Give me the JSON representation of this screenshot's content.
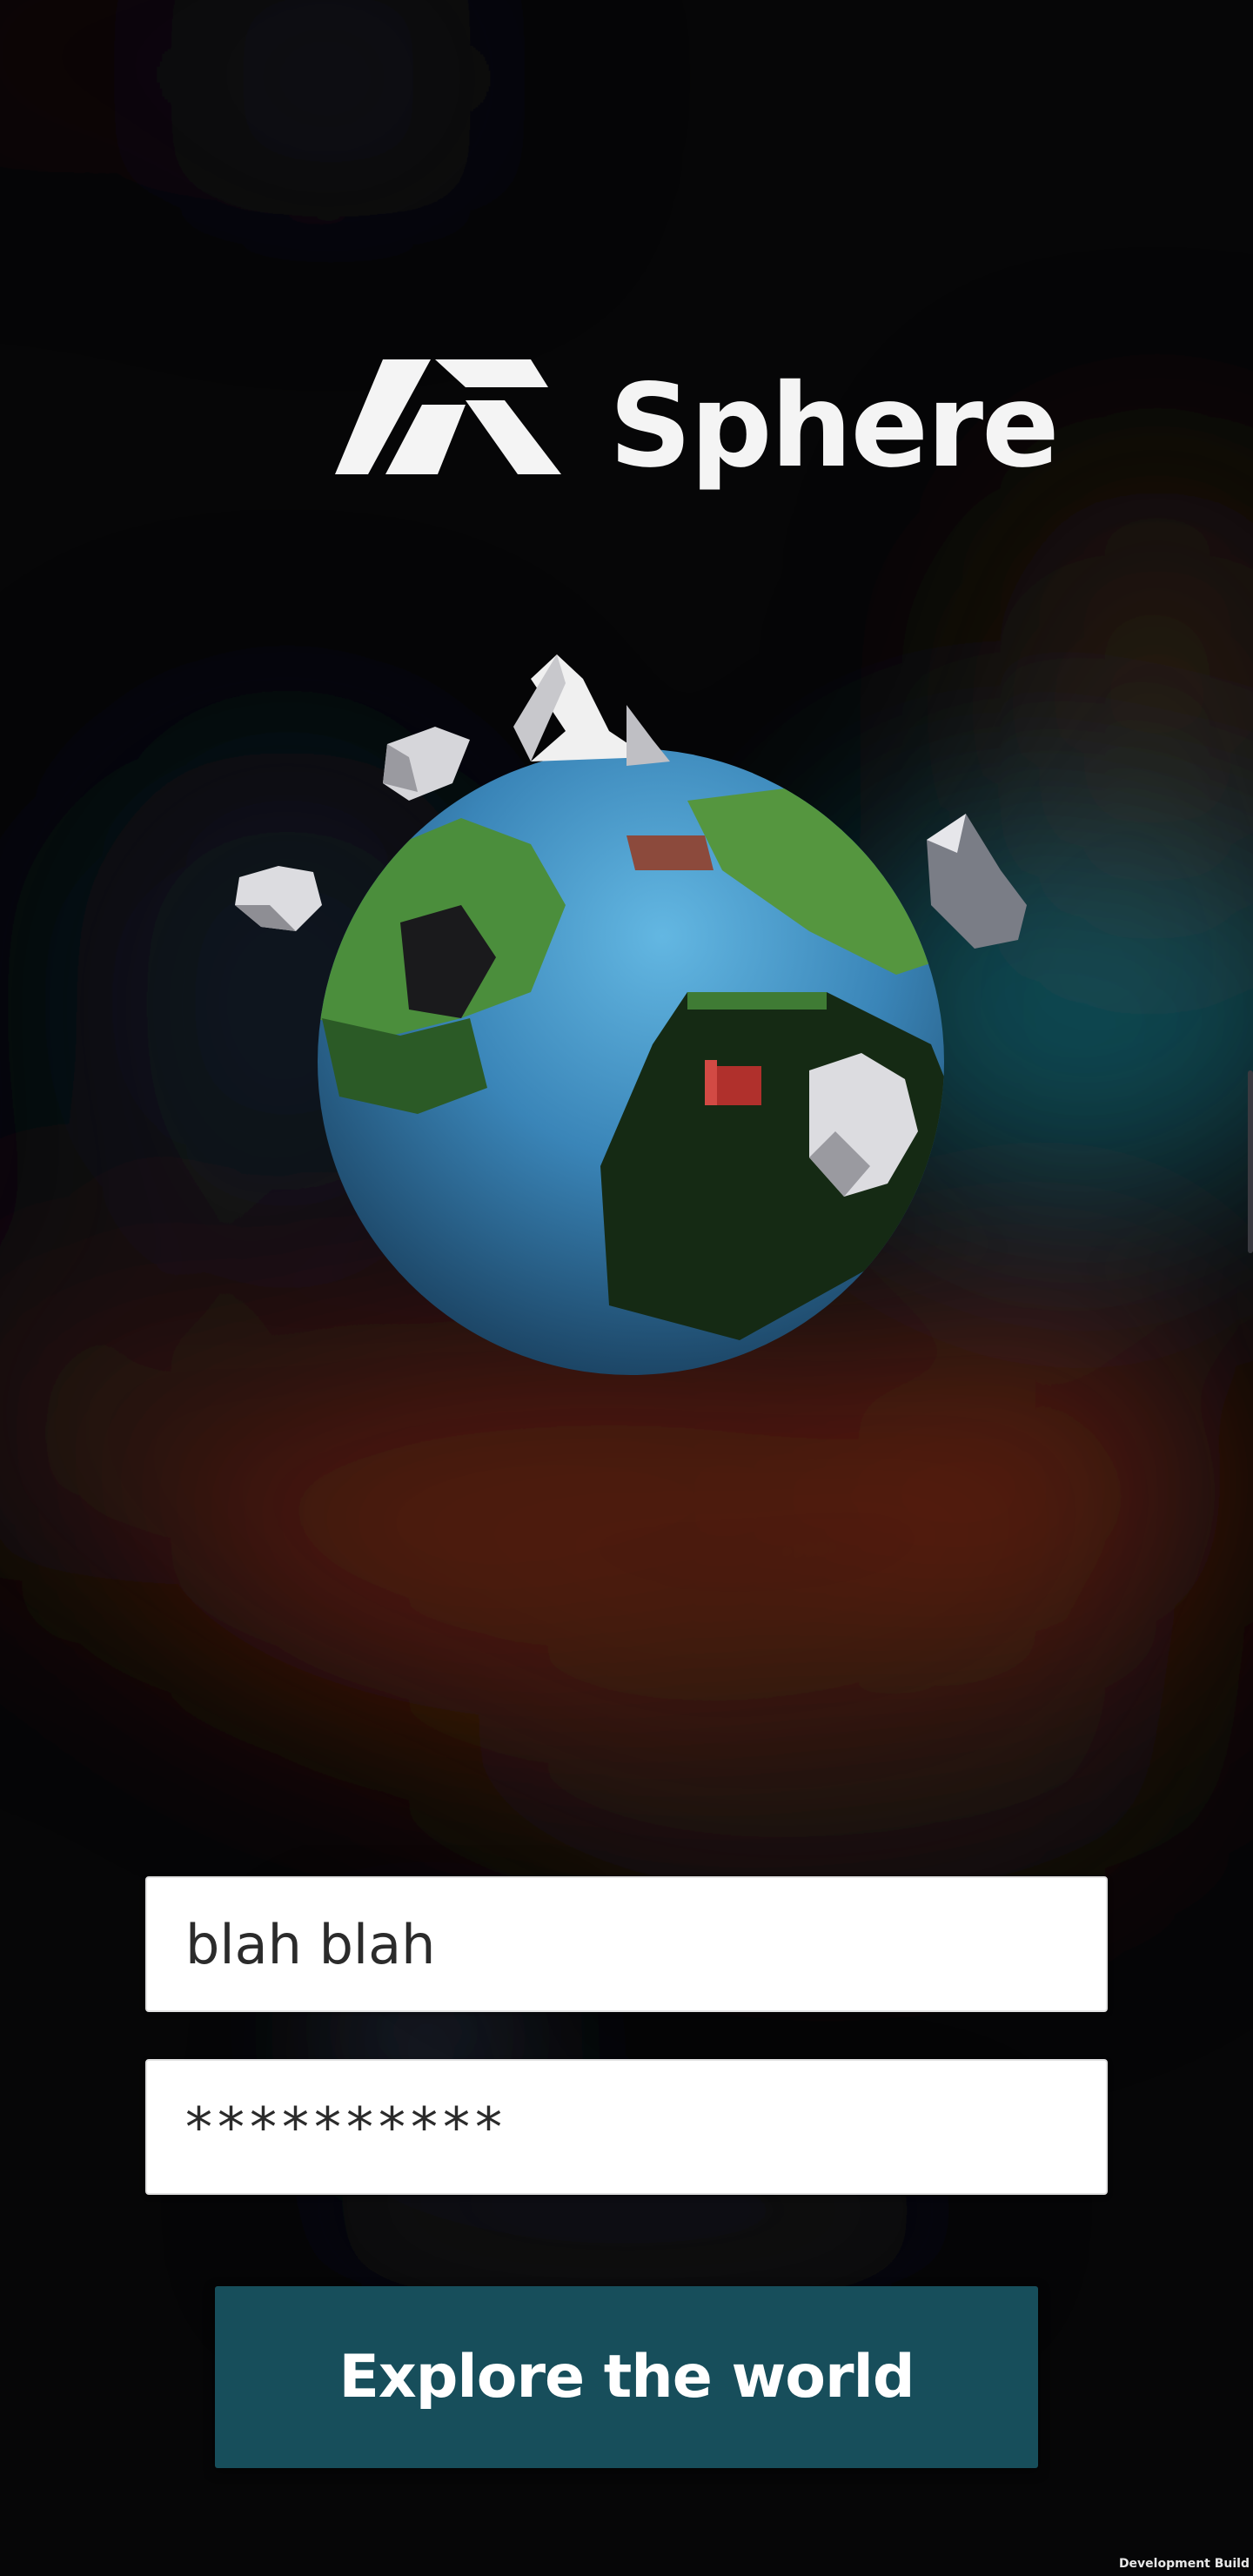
{
  "app": {
    "name": "Sphere"
  },
  "login": {
    "username_value": "blah blah",
    "password_value": "**********",
    "submit_label": "Explore the world"
  },
  "footer": {
    "build_label": "Development Build"
  },
  "colors": {
    "button": "#174e5b",
    "ocean": "#4aa3d6",
    "land": "#3f7b34"
  }
}
